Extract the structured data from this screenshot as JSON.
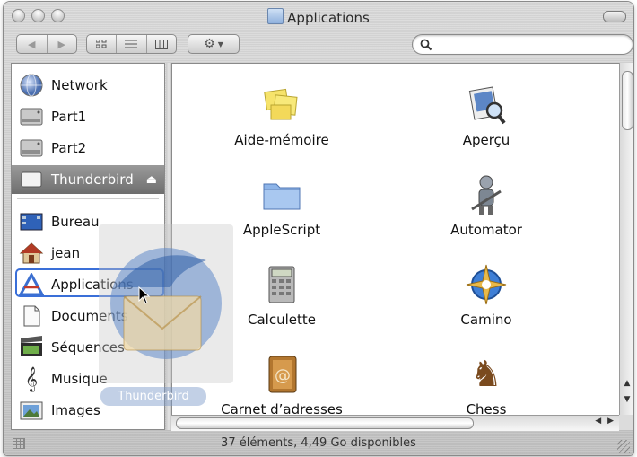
{
  "window": {
    "title": "Applications",
    "status": "37 éléments, 4,49 Go disponibles"
  },
  "search": {
    "value": "",
    "placeholder": ""
  },
  "sidebar": {
    "devices": [
      {
        "label": "Network",
        "icon": "network-globe-icon"
      },
      {
        "label": "Part1",
        "icon": "hard-drive-icon"
      },
      {
        "label": "Part2",
        "icon": "hard-drive-icon"
      },
      {
        "label": "Thunderbird",
        "icon": "disk-image-icon",
        "eject": "⏏"
      }
    ],
    "places": [
      {
        "label": "Bureau",
        "icon": "desktop-icon"
      },
      {
        "label": "jean",
        "icon": "home-icon"
      },
      {
        "label": "Applications",
        "icon": "applications-icon"
      },
      {
        "label": "Documents",
        "icon": "documents-icon"
      },
      {
        "label": "Séquences",
        "icon": "movies-icon"
      },
      {
        "label": "Musique",
        "icon": "music-icon"
      },
      {
        "label": "Images",
        "icon": "pictures-icon"
      }
    ]
  },
  "apps": [
    {
      "label": "Aide-mémoire",
      "icon": "stickies-icon"
    },
    {
      "label": "Aperçu",
      "icon": "preview-icon"
    },
    {
      "label": "AppleScript",
      "icon": "folder-icon"
    },
    {
      "label": "Automator",
      "icon": "automator-icon"
    },
    {
      "label": "Calculette",
      "icon": "calculator-icon"
    },
    {
      "label": "Camino",
      "icon": "camino-icon"
    },
    {
      "label": "Carnet d’adresses",
      "icon": "address-book-icon"
    },
    {
      "label": "Chess",
      "icon": "chess-icon"
    }
  ],
  "drag": {
    "label": "Thunderbird"
  },
  "colors": {
    "selection": "#3a6fd8",
    "thunderbird_bar": "#8a8a8a"
  }
}
